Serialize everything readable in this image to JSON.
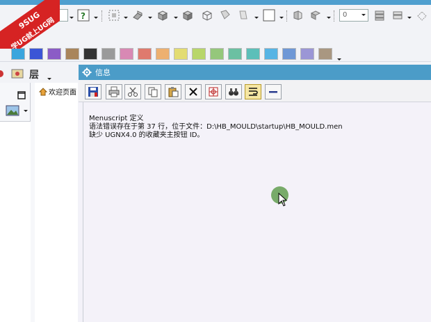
{
  "badge": {
    "line1": "9SUG",
    "line2": "学UG就上UG网"
  },
  "toolbar": {
    "combo_value": "0",
    "layer_label": "层"
  },
  "palette": {
    "colors": [
      "#3aa5dd",
      "#3b55d6",
      "#8b5cc6",
      "#a9855b",
      "#333333",
      "#9a9a9a",
      "#d889b4",
      "#df7a6e",
      "#edb070",
      "#e3dc72",
      "#b8d66a",
      "#95c77b",
      "#6bc0a2",
      "#5cbfb9",
      "#57b4e4",
      "#6f98d6",
      "#9b96d6",
      "#a99781"
    ]
  },
  "resource": {
    "tree_item": "欢迎页面"
  },
  "info": {
    "title": "信息",
    "lines": [
      "Menuscript 定义",
      "语法错误存在于第 37 行，位于文件：D:\\HB_MOULD\\startup\\HB_MOULD.men",
      "缺少 UGNX4.0 的收藏夹主按钮 ID。"
    ]
  }
}
